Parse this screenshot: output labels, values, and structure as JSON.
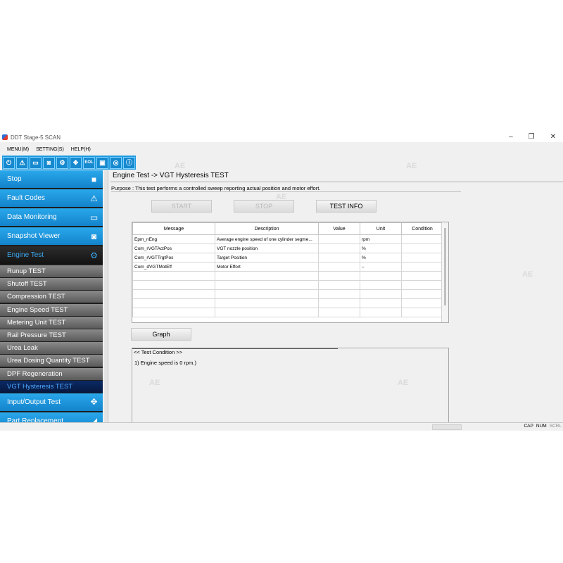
{
  "window": {
    "title": "DDT Stage-5 SCAN",
    "controls": {
      "minimize": "–",
      "maximize": "❐",
      "close": "✕"
    }
  },
  "menu": [
    "MENU(M)",
    "SETTING(S)",
    "HELP(H)"
  ],
  "toolbar": {
    "buttons": [
      {
        "icon": "power-icon",
        "glyph": "⏻"
      },
      {
        "icon": "warning-icon",
        "glyph": "⚠"
      },
      {
        "icon": "monitor-icon",
        "glyph": "▭"
      },
      {
        "icon": "camera-icon",
        "glyph": "◙"
      },
      {
        "icon": "engine-icon",
        "glyph": "⚙"
      },
      {
        "icon": "dpad-icon",
        "glyph": "✥"
      },
      {
        "icon": "eol-icon",
        "label": "EOL"
      },
      {
        "icon": "window-icon",
        "glyph": "▣"
      },
      {
        "icon": "ecu-icon",
        "glyph": "◎"
      },
      {
        "icon": "info-icon",
        "glyph": "ⓘ"
      }
    ]
  },
  "sidebar": {
    "main_top": [
      {
        "label": "Stop",
        "icon": "stop-square-icon",
        "glyph": "■"
      },
      {
        "label": "Fault Codes",
        "icon": "warning-icon",
        "glyph": "⚠"
      },
      {
        "label": "Data Monitoring",
        "icon": "monitor-icon",
        "glyph": "▭"
      },
      {
        "label": "Snapshot Viewer",
        "icon": "camera-icon",
        "glyph": "◙"
      },
      {
        "label": "Engine Test",
        "icon": "engine-icon",
        "glyph": "⚙",
        "active": true
      }
    ],
    "sub_items": [
      "Runup TEST",
      "Shutoff TEST",
      "Compression TEST",
      "Engine Speed TEST",
      "Metering Unit TEST",
      "Rail Pressure TEST",
      "Urea Leak",
      "Urea Dosing Quantity TEST",
      "DPF Regeneration",
      "VGT Hysteresis TEST"
    ],
    "sub_active": "VGT Hysteresis TEST",
    "main_bottom": [
      {
        "label": "Input/Output Test",
        "icon": "dpad-icon",
        "glyph": "✥"
      },
      {
        "label": "Part Replacement",
        "icon": "wrench-icon",
        "glyph": "◢"
      }
    ]
  },
  "content": {
    "title": "Engine Test -> VGT Hysteresis TEST",
    "purpose": "Purpose : This test performs a controlled sweep reporting actual position and motor effort.",
    "buttons": {
      "start": "START",
      "stop": "STOP",
      "test_info": "TEST INFO",
      "graph": "Graph"
    },
    "table": {
      "columns": [
        "Message",
        "Description",
        "Value",
        "Unit",
        "Condition"
      ],
      "rows": [
        [
          "Epm_nEng",
          "Average engine speed of one cylinder segme...",
          "",
          "rpm",
          ""
        ],
        [
          "Com_rVGTActPos",
          "VGT nozzle position",
          "",
          "%",
          ""
        ],
        [
          "Com_rVGTTrgtPos",
          "Target Position",
          "",
          "%",
          ""
        ],
        [
          "Com_dVGTMotEff",
          "Motor Effort",
          "",
          "–",
          ""
        ],
        [
          "",
          "",
          "",
          "",
          ""
        ],
        [
          "",
          "",
          "",
          "",
          ""
        ],
        [
          "",
          "",
          "",
          "",
          ""
        ],
        [
          "",
          "",
          "",
          "",
          ""
        ],
        [
          "",
          "",
          "",
          "",
          ""
        ]
      ]
    },
    "condition": {
      "title": "<< Test Condition >>",
      "text": "1) Engine speed is 0 rpm.)"
    }
  },
  "statusbar": {
    "cap": "CAP",
    "num": "NUM",
    "scrl": "SCRL"
  },
  "watermark": "AE"
}
